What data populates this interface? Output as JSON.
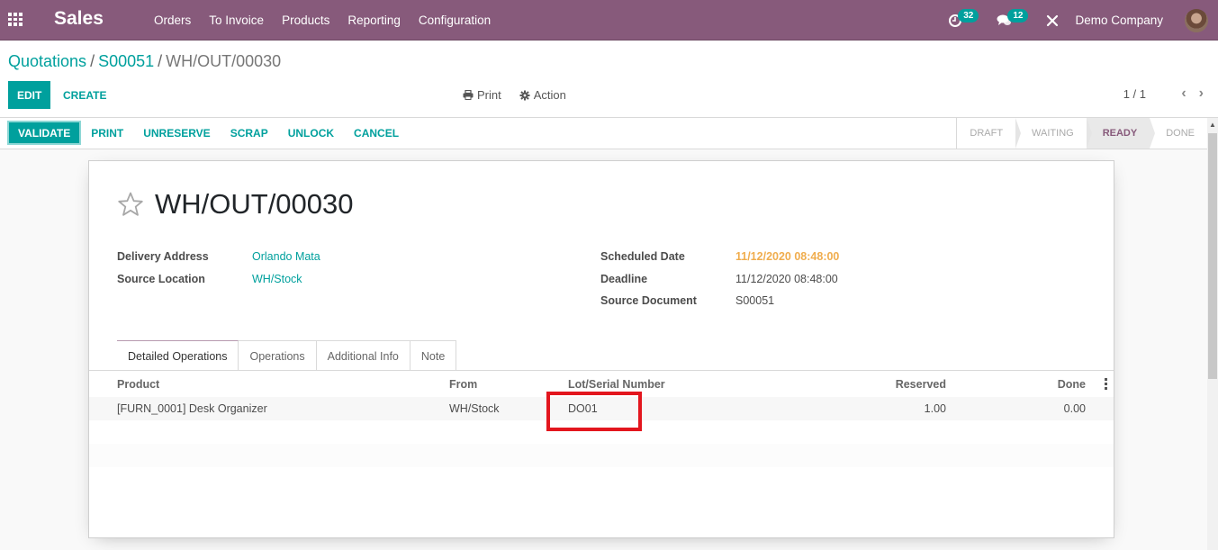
{
  "navbar": {
    "app_name": "Sales",
    "menu": [
      "Orders",
      "To Invoice",
      "Products",
      "Reporting",
      "Configuration"
    ],
    "activity_count": "32",
    "message_count": "12",
    "company": "Demo Company",
    "icons": {
      "apps": "grid-icon",
      "activity": "clock-icon",
      "messages": "chat-icon",
      "debug": "tools-icon"
    }
  },
  "breadcrumb": {
    "items": [
      "Quotations",
      "S00051"
    ],
    "current": "WH/OUT/00030"
  },
  "control_panel": {
    "edit_label": "EDIT",
    "create_label": "CREATE",
    "print_label": "Print",
    "action_label": "Action",
    "pager": "1 / 1"
  },
  "statusbar": {
    "buttons": [
      "VALIDATE",
      "PRINT",
      "UNRESERVE",
      "SCRAP",
      "UNLOCK",
      "CANCEL"
    ],
    "stages": [
      "DRAFT",
      "WAITING",
      "READY",
      "DONE"
    ],
    "active_stage": "READY"
  },
  "form": {
    "title": "WH/OUT/00030",
    "left_fields": [
      {
        "label": "Delivery Address",
        "value": "Orlando Mata"
      },
      {
        "label": "Source Location",
        "value": "WH/Stock"
      }
    ],
    "right_fields": [
      {
        "label": "Scheduled Date",
        "value": "11/12/2020 08:48:00"
      },
      {
        "label": "Deadline",
        "value": "11/12/2020 08:48:00"
      },
      {
        "label": "Source Document",
        "value": "S00051"
      }
    ],
    "colors": {
      "accent": "#00a09d",
      "brand": "#875a7b",
      "warning": "#f0ad4e",
      "highlight": "#e3161e"
    }
  },
  "notebook": {
    "tabs": [
      "Detailed Operations",
      "Operations",
      "Additional Info",
      "Note"
    ],
    "active_tab": "Detailed Operations"
  },
  "table": {
    "columns": [
      "Product",
      "From",
      "Lot/Serial Number",
      "Reserved",
      "Done"
    ],
    "rows": [
      {
        "product": "[FURN_0001] Desk Organizer",
        "from": "WH/Stock",
        "lot": "DO01",
        "reserved": "1.00",
        "done": "0.00"
      }
    ]
  }
}
